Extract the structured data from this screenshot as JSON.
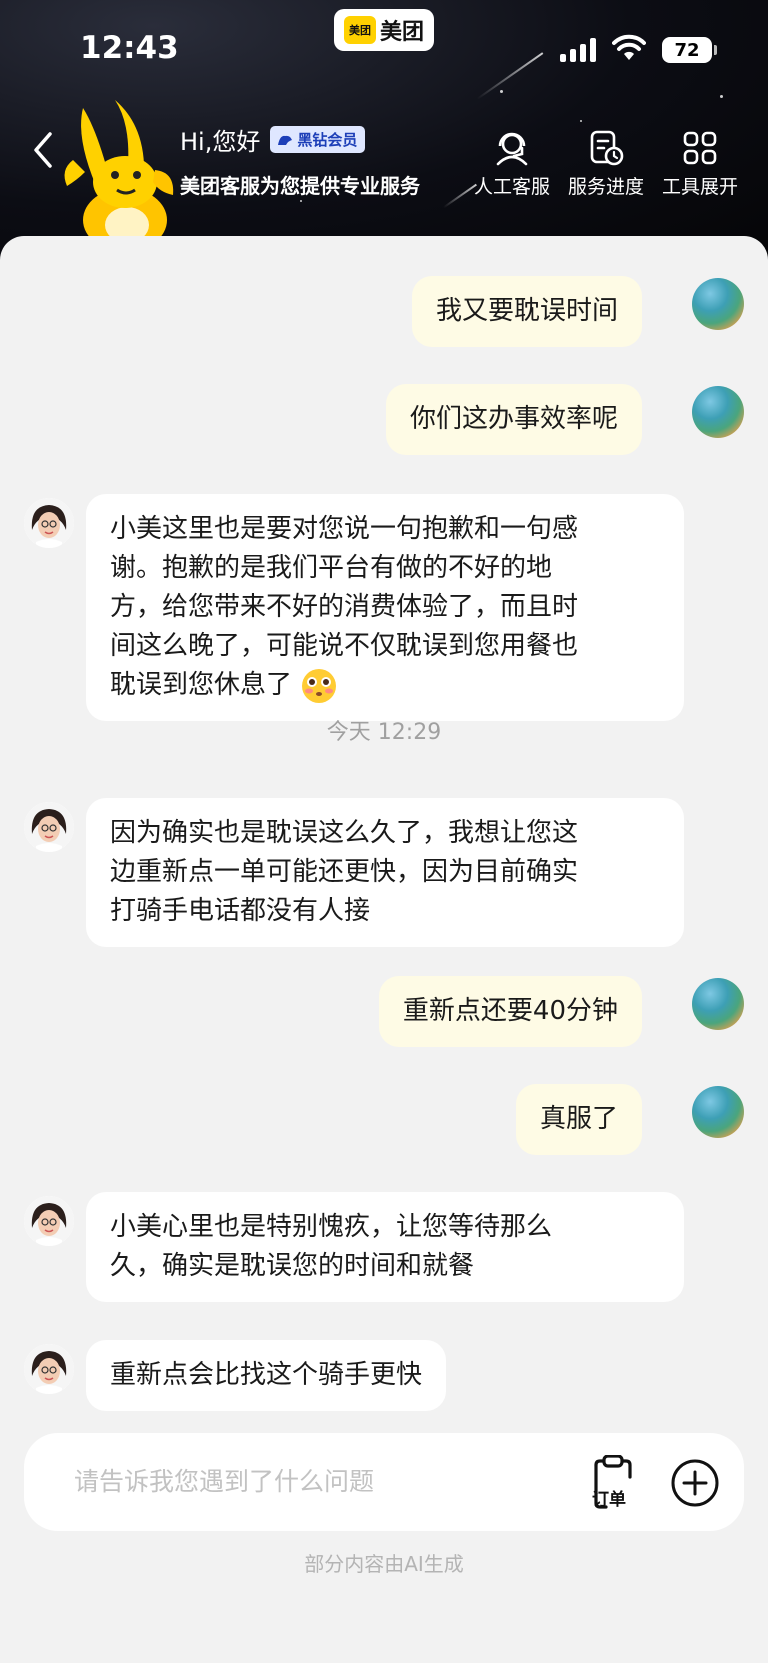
{
  "status_bar": {
    "time": "12:43",
    "app_name": "美团",
    "app_logo_text": "美团",
    "battery": "72"
  },
  "header": {
    "greeting": "Hi,您好",
    "vip_badge": "黑钻会员",
    "subtitle": "美团客服为您提供专业服务",
    "tools": [
      {
        "label": "人工客服",
        "icon": "headset-icon"
      },
      {
        "label": "服务进度",
        "icon": "progress-clock-icon"
      },
      {
        "label": "工具展开",
        "icon": "grid-icon"
      }
    ]
  },
  "messages": [
    {
      "role": "user",
      "text": "我又要耽误时间"
    },
    {
      "role": "user",
      "text": "你们这办事效率呢"
    },
    {
      "role": "bot",
      "text": "小美这里也是要对您说一句抱歉和一句感\n谢。抱歉的是我们平台有做的不好的地\n方，给您带来不好的消费体验了，而且时\n间这么晚了，可能说不仅耽误到您用餐也\n耽误到您休息了"
    },
    {
      "role": "timestamp",
      "text": "今天 12:29"
    },
    {
      "role": "bot",
      "text": "因为确实也是耽误这么久了，我想让您这\n边重新点一单可能还更快，因为目前确实\n打骑手电话都没有人接"
    },
    {
      "role": "user",
      "text": "重新点还要40分钟"
    },
    {
      "role": "user",
      "text": "真服了"
    },
    {
      "role": "bot",
      "text": "小美心里也是特别愧疚，让您等待那么\n久，确实是耽误您的时间和就餐"
    },
    {
      "role": "bot",
      "text": "重新点会比找这个骑手更快"
    }
  ],
  "input": {
    "placeholder": "请告诉我您遇到了什么问题",
    "order_label": "订单"
  },
  "footer": {
    "ai_note": "部分内容由AI生成"
  },
  "colors": {
    "user_bubble": "#fefbe5",
    "bot_bubble": "#ffffff",
    "background": "#f2f2f2",
    "brand_yellow": "#ffd100"
  }
}
